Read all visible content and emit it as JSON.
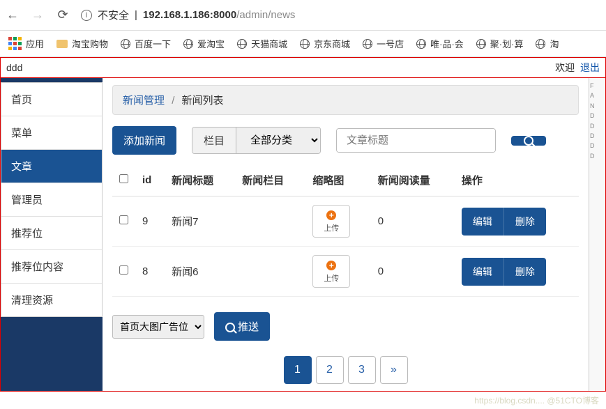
{
  "browser": {
    "security_label": "不安全",
    "url_host": "192.168.1.186:8000",
    "url_path": "/admin/news"
  },
  "bookmarks": {
    "apps": "应用",
    "items": [
      "淘宝购物",
      "百度一下",
      "爱淘宝",
      "天猫商城",
      "京东商城",
      "一号店",
      "唯·品·会",
      "聚·划·算",
      "淘"
    ]
  },
  "top_strip": {
    "left": "ddd",
    "welcome": "欢迎",
    "logout": "退出"
  },
  "sidebar": {
    "items": [
      {
        "label": "首页"
      },
      {
        "label": "菜单"
      },
      {
        "label": "文章",
        "active": true
      },
      {
        "label": "管理员"
      },
      {
        "label": "推荐位"
      },
      {
        "label": "推荐位内容"
      },
      {
        "label": "清理资源"
      }
    ]
  },
  "breadcrumb": {
    "parent": "新闻管理",
    "current": "新闻列表"
  },
  "toolbar": {
    "add_label": "添加新闻",
    "filter_addon": "栏目",
    "filter_options": [
      "全部分类"
    ],
    "search_placeholder": "文章标题"
  },
  "table": {
    "headers": {
      "id": "id",
      "title": "新闻标题",
      "category": "新闻栏目",
      "thumb": "缩略图",
      "reads": "新闻阅读量",
      "ops": "操作"
    },
    "upload_label": "上传",
    "rows": [
      {
        "id": "9",
        "title": "新闻7",
        "category": "",
        "reads": "0"
      },
      {
        "id": "8",
        "title": "新闻6",
        "category": "",
        "reads": "0"
      }
    ],
    "actions": {
      "edit": "编辑",
      "delete": "删除"
    }
  },
  "push": {
    "options": [
      "首页大图广告位"
    ],
    "button": "推送"
  },
  "pagination": {
    "pages": [
      "1",
      "2",
      "3"
    ],
    "next": "»",
    "active": 1
  },
  "watermark": "https://blog.csdn.... @51CTO博客",
  "side_letters": [
    "F",
    "A",
    "N",
    "D",
    "D",
    "D",
    "D",
    "D"
  ]
}
